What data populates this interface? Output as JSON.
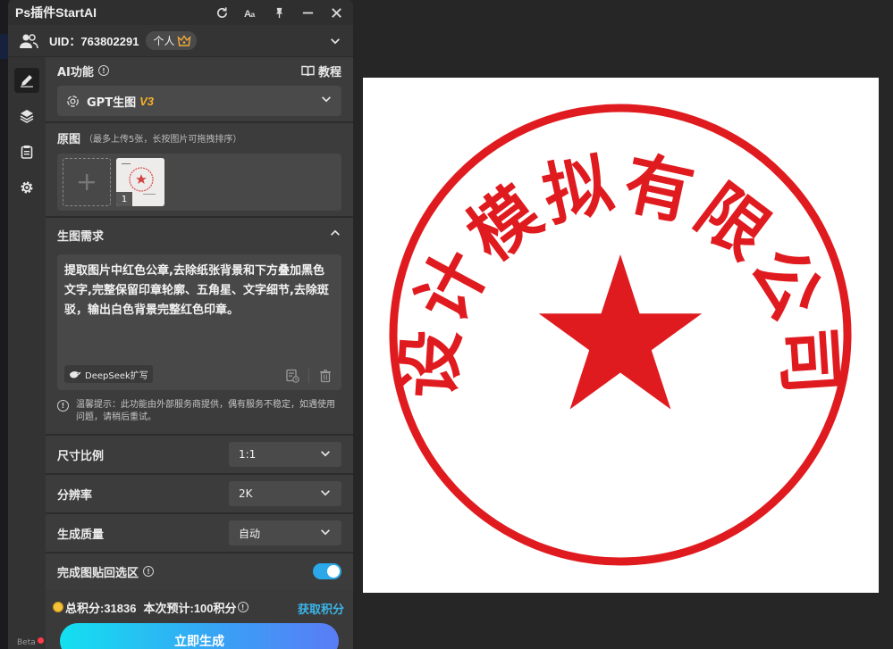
{
  "window": {
    "title": "Ps插件StartAI"
  },
  "user": {
    "uid_label": "UID：763802291",
    "plan_badge": "个人"
  },
  "ai_section": {
    "title": "AI功能",
    "tutorial_label": "教程",
    "model_name": "GPT生图",
    "model_version": "V3"
  },
  "original_section": {
    "title": "原图",
    "hint": "（最多上传5张，长按图片可拖拽排序）",
    "thumbnails": [
      {
        "index": "1"
      }
    ]
  },
  "requirement_section": {
    "title": "生图需求",
    "prompt_text": "提取图片中红色公章,去除纸张背景和下方叠加黑色文字,完整保留印章轮廓、五角星、文字细节,去除斑驳，输出白色背景完整红色印章。",
    "deepseek_label": "DeepSeek扩写",
    "notice": "温馨提示：此功能由外部服务商提供，偶有服务不稳定，如遇使用问题，请稍后重试。"
  },
  "settings": {
    "ratio": {
      "label": "尺寸比例",
      "value": "1:1"
    },
    "resolution": {
      "label": "分辨率",
      "value": "2K"
    },
    "quality": {
      "label": "生成质量",
      "value": "自动"
    },
    "paste_back": {
      "label": "完成图贴回选区",
      "enabled": true
    }
  },
  "footer": {
    "total_points": "总积分:31836",
    "estimate": "本次预计:100积分",
    "get_points": "获取积分",
    "generate_button": "立即生成",
    "beta_label": "Beta"
  },
  "canvas": {
    "seal_text": "设计模拟有限公司",
    "seal_color": "#e01b1f"
  },
  "colors": {
    "accent": "#2aa8ea",
    "version": "#f6b02b"
  }
}
